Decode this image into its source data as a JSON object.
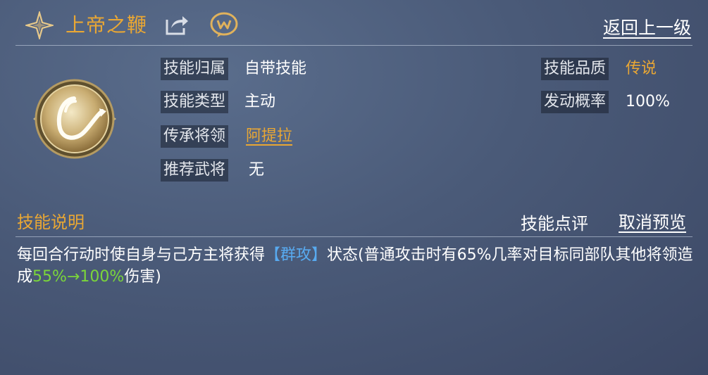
{
  "header": {
    "title": "上帝之鞭",
    "back_label": "返回上一级"
  },
  "skill_info": {
    "ownership_label": "技能归属",
    "ownership_value": "自带技能",
    "type_label": "技能类型",
    "type_value": "主动",
    "inherit_label": "传承将领",
    "inherit_value": "阿提拉",
    "recommend_label": "推荐武将",
    "recommend_value": "无",
    "quality_label": "技能品质",
    "quality_value": "传说",
    "rate_label": "发动概率",
    "rate_value": "100%"
  },
  "description": {
    "section_title": "技能说明",
    "comment_button": "技能点评",
    "cancel_preview_button": "取消预览",
    "text_1": "每回合行动时使自身与己方主将获得",
    "buff_name": "【群攻】",
    "text_2": "状态(普通攻击时有65%几率对目标同部队其他将领造成",
    "damage_range": "55%→100%",
    "text_3": "伤害)"
  },
  "icons": {
    "title_icon": "four-point-star-icon",
    "share_icon": "share-icon",
    "chat_icon": "chat-bubble-icon",
    "skill_badge": "whip-skill-emblem",
    "accent_color": "#e9a734",
    "buff_color": "#58aaf0",
    "damage_color": "#7bd63a"
  }
}
